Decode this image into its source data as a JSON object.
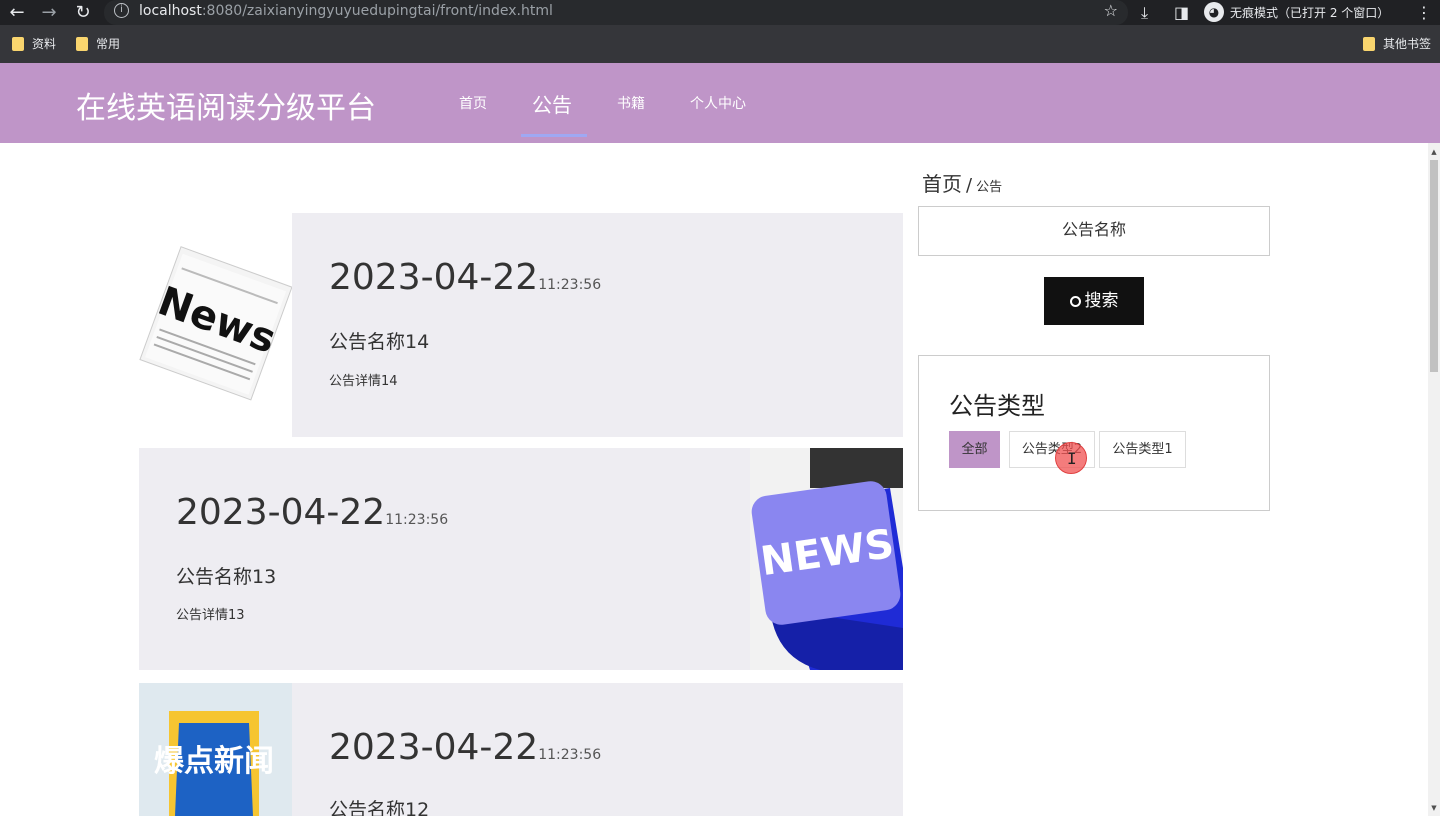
{
  "browser": {
    "url_host": "localhost",
    "url_rest": ":8080/zaixianyingyuyuedupingtai/front/index.html",
    "incognito_label": "无痕模式（已打开 2 个窗口）",
    "bookmarks": [
      "资料",
      "常用"
    ],
    "other_bookmarks": "其他书签"
  },
  "site": {
    "logo": "在线英语阅读分级平台",
    "nav": [
      "首页",
      "公告",
      "书籍",
      "个人中心"
    ],
    "active_nav": "公告",
    "accent_color": "#bf95c8"
  },
  "notices": [
    {
      "date": "2023-04-22",
      "time": "11:23:56",
      "title": "公告名称14",
      "detail": "公告详情14",
      "image": "news-newspaper-image"
    },
    {
      "date": "2023-04-22",
      "time": "11:23:56",
      "title": "公告名称13",
      "detail": "公告详情13",
      "image": "news-keyboard-key-image"
    },
    {
      "date": "2023-04-22",
      "time": "11:23:56",
      "title": "公告名称12",
      "detail": "",
      "image": "breaking-news-poster-image",
      "image_text": "爆点新闻"
    }
  ],
  "sidebar": {
    "breadcrumb_home": "首页",
    "breadcrumb_sep": "/",
    "breadcrumb_current": "公告",
    "search_placeholder": "公告名称",
    "search_button": "搜索",
    "type_title": "公告类型",
    "types": [
      "全部",
      "公告类型2",
      "公告类型1"
    ],
    "selected_type": "全部"
  }
}
